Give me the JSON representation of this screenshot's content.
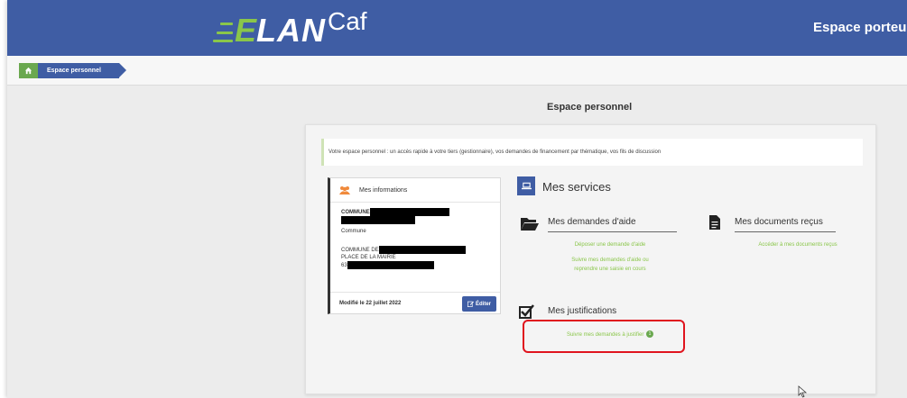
{
  "header": {
    "logo_e": "E",
    "logo_lan": "LAN",
    "logo_caf": "Caf",
    "right_title": "Espace porteurs"
  },
  "breadcrumb": {
    "home_icon": "home-icon",
    "current": "Espace personnel"
  },
  "page": {
    "title": "Espace personnel"
  },
  "intro_text": "Votre espace personnel : un accès rapide à votre tiers (gestionnaire), vos demandes de financement par thématique, vos fils de discussion",
  "info": {
    "title": "Mes informations",
    "line1": "COMMUNE",
    "type": "Commune",
    "addr1": "COMMUNE DE",
    "addr2": "PLACE DE LA MAIRIE",
    "addr3": "63",
    "modified": "Modifié le 22 juillet 2022",
    "edit_label": "Éditer"
  },
  "services": {
    "title": "Mes services",
    "demandes": {
      "label": "Mes demandes d'aide",
      "link1": "Déposer une demande d'aide",
      "link2a": "Suivre mes demandes d'aide ou",
      "link2b": "reprendre une saisie en cours"
    },
    "documents": {
      "label": "Mes documents reçus",
      "link1": "Accéder à mes documents reçus"
    },
    "justifications": {
      "label": "Mes justifications",
      "link1": "Suivre mes demandes à justifier",
      "badge": "1"
    }
  },
  "colors": {
    "brand_blue": "#3f5da4",
    "accent_green": "#8ac64a",
    "highlight_red": "#e0141e"
  }
}
